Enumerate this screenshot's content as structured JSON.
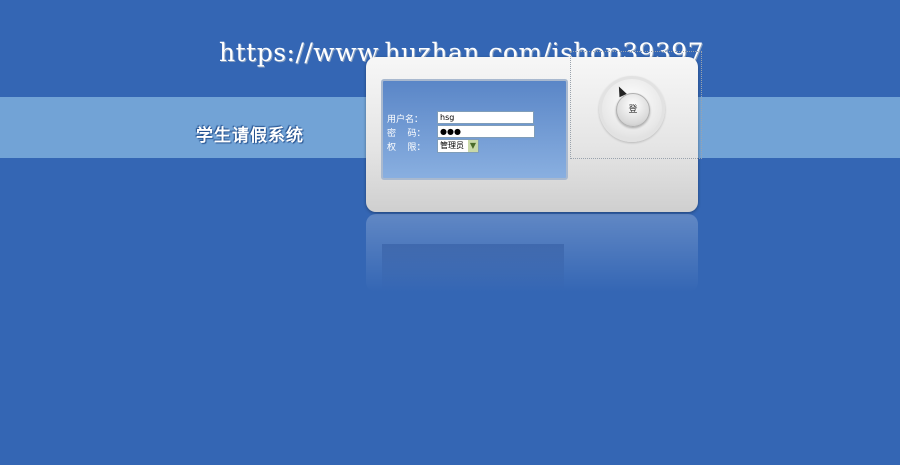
{
  "watermark": "https://www.huzhan.com/ishop39397",
  "system_title": "学生请假系统",
  "form": {
    "username_label": "用户名：",
    "username_value": "hsg",
    "password_label": "密    码：",
    "password_value": "●●●",
    "role_label": "权    限：",
    "role_value": "管理员"
  },
  "login_button_label": "登",
  "icons": {
    "dropdown": "chevron-down-icon",
    "cursor": "mouse-pointer-icon"
  },
  "colors": {
    "background": "#3466b4",
    "band": "#72a3d6"
  }
}
